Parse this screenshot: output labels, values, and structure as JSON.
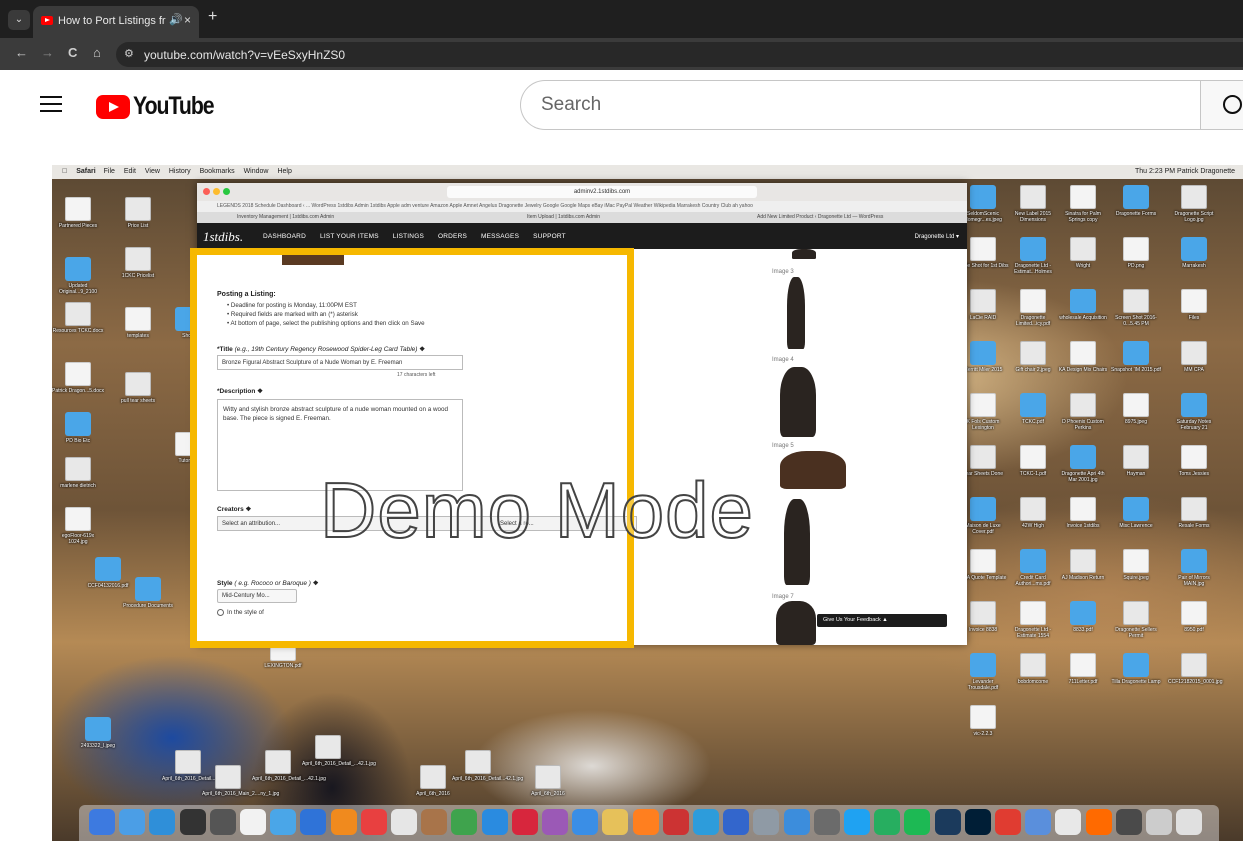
{
  "browser": {
    "tab": {
      "title": "How to Port Listings from 1",
      "audio_icon": "🔊",
      "close": "×"
    },
    "new_tab": "+",
    "url": "youtube.com/watch?v=vEeSxyHnZS0",
    "nav": {
      "back": "←",
      "forward": "→",
      "reload": "C",
      "home": "⌂"
    }
  },
  "youtube": {
    "logo_text": "YouTube",
    "search_placeholder": "Search"
  },
  "video": {
    "mac_menubar": {
      "app": "Safari",
      "items": [
        "File",
        "Edit",
        "View",
        "History",
        "Bookmarks",
        "Window",
        "Help"
      ],
      "status": "Thu 2:23 PM   Patrick Dragonette"
    },
    "safari": {
      "address": "adminv2.1stdibs.com",
      "favorites": "LEGENDS 2018 Schedule   Dashboard ‹ ... WordPress   1stdibs   Admin 1stdibs   Apple   adm venture   Amazon   Apple   Amnet   Angelus   Dragonette Jewelry   Google   Google Maps   eBay   iMac   PayPal   Weather   Wikipedia   Marrakesh Country Club   ah yahoo",
      "tabs": [
        "Inventory Management | 1stdibs.com Admin",
        "Item Upload | 1stdibs.com Admin",
        "Add New Limited Product ‹ Dragonette Ltd — WordPress"
      ]
    },
    "site": {
      "logo": "1stdibs.",
      "nav": [
        "DASHBOARD",
        "LIST YOUR ITEMS",
        "LISTINGS",
        "ORDERS",
        "MESSAGES",
        "SUPPORT"
      ],
      "account": "Dragonette Ltd ▾"
    },
    "form": {
      "posting_title": "Posting a Listing:",
      "bullets": [
        "Deadline for posting is Monday, 11:00PM EST",
        "Required fields are marked with an (*) asterisk",
        "At bottom of page, select the publishing options and then click on Save"
      ],
      "title_label": "*Title",
      "title_hint": "(e.g., 19th Century Regency Rosewood Spider-Leg Card Table)",
      "title_value": "Bronze Figural Abstract Sculpture of a Nude Woman by E. Freeman",
      "char_count": "17 characters left",
      "description_label": "*Description",
      "description_value": "Witty and stylish bronze abstract sculpture of a nude woman mounted on a wood base. The piece is signed E. Freeman.",
      "creators_label": "Creators",
      "creators_placeholder": "Select an attribution...",
      "creators_role": "Select a ro...",
      "style_label": "Style",
      "style_hint": "( e.g. Rococo or Baroque )",
      "style_value": "Mid-Century Mo...",
      "radio_option": "In the style of"
    },
    "images": [
      "Image 3",
      "Image 4",
      "Image 5",
      "Image 7"
    ],
    "feedback": "Give Us Your Feedback ▲",
    "overlay_text": "Demo Mode",
    "desktop_left": [
      "Partnered Pieces",
      "Updated Original...9_2100",
      "Resources TCKC.docx",
      "Patrick Dragon...5.docx",
      "PD Bio Etc",
      "marlene dietrich",
      "egoFloor-619x 1024.jpg",
      "Procedure Documents",
      "1CKC Pricelist",
      "templates",
      "Shop",
      "pull tear sheets",
      "Tutorials",
      "CCF04132016.pdf",
      "Price List",
      "LEXINGTON.pdf",
      "2493322_l.jpeg"
    ],
    "desktop_right": [
      "SeldomScenic Homegr...es.jpeg",
      "New Label 2015 Dimensions",
      "Sinatra for Palm Springs copy",
      "Dragonette Forms",
      "Dragonette Script Logo.jpg",
      "To Be Shot for 1st Dibs",
      "Dragonette Ltd - Estimat...Holmes",
      "Wright",
      "PD.png",
      "Marrakesh",
      "LaCie RAID",
      "Dragonette Limited...icy.pdf",
      "wholesale Acquisition",
      "Screen Shot 2016-0...5.45 PM",
      "Files",
      "Merritt Miler 2015",
      "Gift chair 2.jpeg",
      "KA Design Mix Chairs",
      "Snapshot 'IM 2015.pdf",
      "MM CPA",
      "K Fols Custom Lexington",
      "TCKC.pdf",
      "D Phoenix Custom Perkins",
      "8975.jpeg",
      "Saturday Notes February 21",
      "Tear Sheets Done",
      "TCKC-1.pdf",
      "Dragonette Apri 4th Mar 2001.jpg",
      "Hayman",
      "Toms Jessies",
      "Maison de Luxe Cover.pdf",
      "42W High",
      "Invoice 1stdibs",
      "Misc Lawrence",
      "Resale Forms",
      "DDA Quote Template",
      "Credit Card Authori...ms.pdf",
      "AJ Madison Return",
      "Squire.jpeg",
      "Pair of Mirrors MAIN.jpg",
      "Invoice 8838",
      "Dragonette Ltd - Estimate 1554",
      "8833.pdf",
      "Dragonette Sellers Permit",
      "8950.pdf",
      "Levander Trousdale.pdf",
      "bobdomcome",
      "711Letter.pdf",
      "Tilla Dragonette Lamp",
      "CCF12182015_0001.jpg",
      "vic-2.2.3"
    ],
    "desktop_bottom": [
      "April_6th_2016_Detail...42.1.jpg",
      "April_6th_2016_Main_2....ny_1.jpg",
      "April_6th_2016_Detail_...42.1.jpg",
      "April_6th_2016_Detail_...42.1.jpg",
      "April_6th_2016",
      "April_6th_2016_Detail...42.1.jpg",
      "April_6th_2016"
    ],
    "dock_colors": [
      "#3d7ae0",
      "#4b9ee6",
      "#2f8fd9",
      "#333333",
      "#555555",
      "#f2f2f2",
      "#4aa6e8",
      "#2f73d8",
      "#f08a1e",
      "#e84040",
      "#e6e6e6",
      "#a8744a",
      "#3fa34d",
      "#2a8be0",
      "#d7263d",
      "#9b59b6",
      "#3a8ee6",
      "#e6c15a",
      "#ff7f1f",
      "#cc3333",
      "#2d9cdb",
      "#3366cc",
      "#8f9aa5",
      "#3c8ddc",
      "#6b6b6b",
      "#1fa2f2",
      "#27ae60",
      "#1db954",
      "#1b3a5c",
      "#001e36",
      "#e03c31",
      "#5a8fdc",
      "#e8e8e8",
      "#ff6a00",
      "#4a4a4a",
      "#cccccc",
      "#e0e0e0"
    ]
  }
}
